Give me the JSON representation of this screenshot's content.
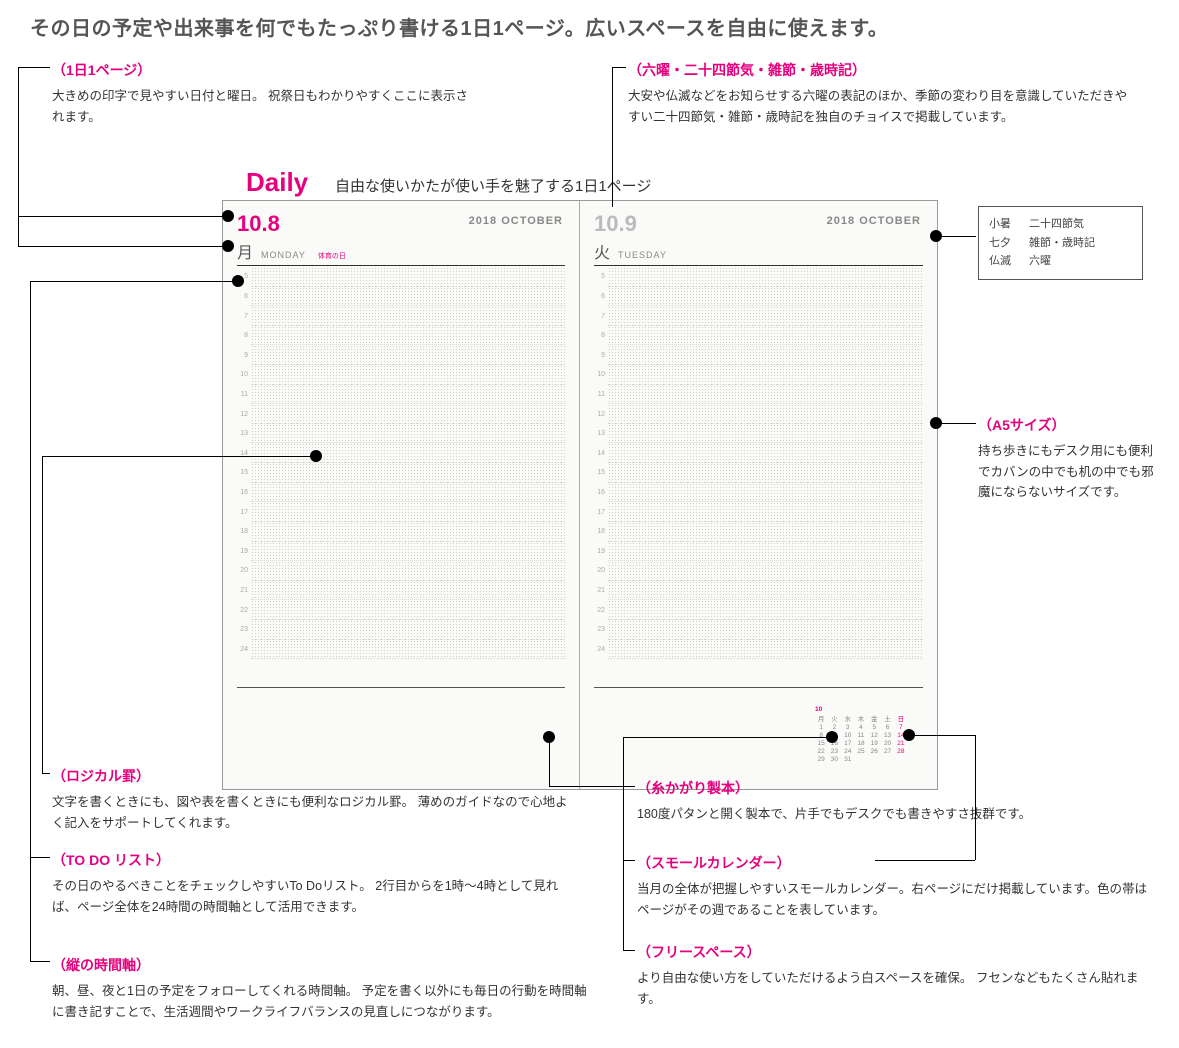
{
  "headline": "その日の予定や出来事を何でもたっぷり書ける1日1ページ。広いスペースを自由に使えます。",
  "diary": {
    "title": "Daily",
    "subtitle": "自由な使いかたが使い手を魅了する1日1ページ",
    "left": {
      "date": "10.8",
      "month": "2018  OCTOBER",
      "dow_kanji": "月",
      "dow_en": "MONDAY",
      "holiday": "体育の日"
    },
    "right": {
      "date": "10.9",
      "month": "2018  OCTOBER",
      "dow_kanji": "火",
      "dow_en": "TUESDAY"
    },
    "hours": [
      "5",
      "6",
      "7",
      "8",
      "9",
      "10",
      "11",
      "12",
      "13",
      "14",
      "15",
      "16",
      "17",
      "18",
      "19",
      "20",
      "21",
      "22",
      "23",
      "24"
    ],
    "minical": {
      "month": "10",
      "dow": [
        "月",
        "火",
        "水",
        "木",
        "金",
        "土",
        "日"
      ],
      "cells": [
        "1",
        "2",
        "3",
        "4",
        "5",
        "6",
        "7",
        "8",
        "9",
        "10",
        "11",
        "12",
        "13",
        "14",
        "15",
        "16",
        "17",
        "18",
        "19",
        "20",
        "21",
        "22",
        "23",
        "24",
        "25",
        "26",
        "27",
        "28",
        "29",
        "30",
        "31",
        "",
        "",
        ""
      ]
    }
  },
  "legend": [
    {
      "s": "小暑",
      "l": "二十四節気"
    },
    {
      "s": "七夕",
      "l": "雑節・歳時記"
    },
    {
      "s": "仏滅",
      "l": "六曜"
    }
  ],
  "sections": {
    "daypage": {
      "title": "（1日1ページ）",
      "body": "大きめの印字で見やすい日付と曜日。\n祝祭日もわかりやすくここに表示されます。"
    },
    "rokuyo": {
      "title": "（六曜・二十四節気・雑節・歳時記）",
      "body": "大安や仏滅などをお知らせする六曜の表記のほか、季節の変わり目を意識していただきやすい二十四節気・雑節・歳時記を独自のチョイスで掲載しています。"
    },
    "a5": {
      "title": "（A5サイズ）",
      "body": "持ち歩きにもデスク用にも便利でカバンの中でも机の中でも邪魔にならないサイズです。"
    },
    "logical": {
      "title": "（ロジカル罫）",
      "body": "文字を書くときにも、図や表を書くときにも便利なロジカル罫。\n薄めのガイドなので心地よく記入をサポートしてくれます。"
    },
    "todo": {
      "title": "（TO DO リスト）",
      "body": "その日のやるべきことをチェックしやすいTo Doリスト。\n2行目からを1時〜4時として見れば、ページ全体を24時間の時間軸として活用できます。"
    },
    "vtime": {
      "title": "（縦の時間軸）",
      "body": "朝、昼、夜と1日の予定をフォローしてくれる時間軸。\n予定を書く以外にも毎日の行動を時間軸に書き記すことで、生活週間やワークライフバランスの見直しにつながります。"
    },
    "binding": {
      "title": "（糸かがり製本）",
      "body": "180度パタンと開く製本で、片手でもデスクでも書きやすさ抜群です。"
    },
    "smallcal": {
      "title": "（スモールカレンダー）",
      "body": "当月の全体が把握しやすいスモールカレンダー。右ページにだけ掲載しています。色の帯はページがその週であることを表しています。"
    },
    "freespace": {
      "title": "（フリースペース）",
      "body": "より自由な使い方をしていただけるよう白スペースを確保。\nフセンなどもたくさん貼れます。"
    }
  }
}
